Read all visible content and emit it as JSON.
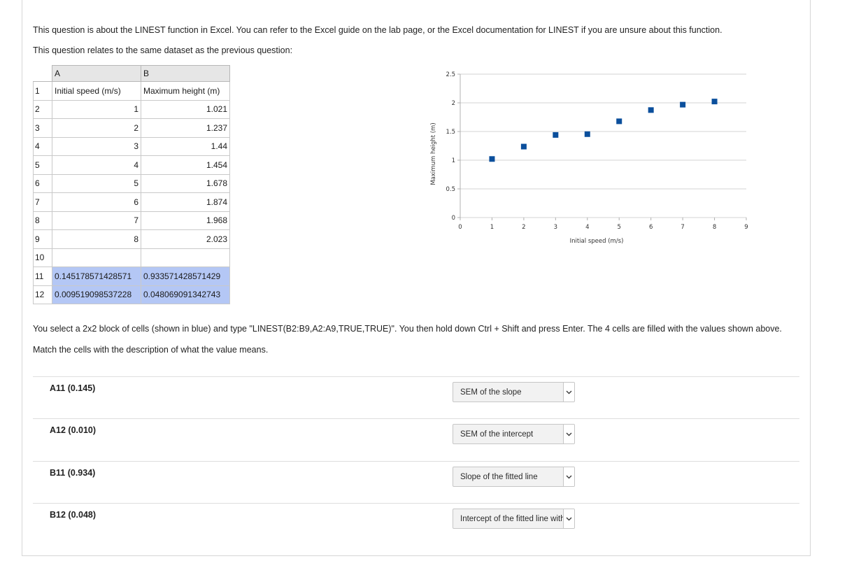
{
  "intro": {
    "line1": "This question is about the LINEST function in Excel. You can refer to the Excel guide on the lab page, or the Excel documentation for LINEST if you are unsure about this function.",
    "line2": "This question relates to the same dataset as the previous question:"
  },
  "sheet": {
    "col_headers": [
      "A",
      "B"
    ],
    "rows": [
      {
        "n": "1",
        "a": "Initial speed (m/s)",
        "b": "Maximum height (m)"
      },
      {
        "n": "2",
        "a": "1",
        "b": "1.021"
      },
      {
        "n": "3",
        "a": "2",
        "b": "1.237"
      },
      {
        "n": "4",
        "a": "3",
        "b": "1.44"
      },
      {
        "n": "5",
        "a": "4",
        "b": "1.454"
      },
      {
        "n": "6",
        "a": "5",
        "b": "1.678"
      },
      {
        "n": "7",
        "a": "6",
        "b": "1.874"
      },
      {
        "n": "8",
        "a": "7",
        "b": "1.968"
      },
      {
        "n": "9",
        "a": "8",
        "b": "2.023"
      },
      {
        "n": "10",
        "a": "",
        "b": ""
      },
      {
        "n": "11",
        "a": "0.145178571428571",
        "b": "0.933571428571429"
      },
      {
        "n": "12",
        "a": "0.009519098537228",
        "b": "0.048069091342743"
      }
    ]
  },
  "chart_data": {
    "type": "scatter",
    "title": "",
    "xlabel": "Initial speed (m/s)",
    "ylabel": "Maximum height (m)",
    "x": [
      1,
      2,
      3,
      4,
      5,
      6,
      7,
      8
    ],
    "y": [
      1.021,
      1.237,
      1.44,
      1.454,
      1.678,
      1.874,
      1.968,
      2.023
    ],
    "xlim": [
      0,
      9
    ],
    "ylim": [
      0,
      2.5
    ],
    "xticks": [
      "0",
      "1",
      "2",
      "3",
      "4",
      "5",
      "6",
      "7",
      "8",
      "9"
    ],
    "yticks": [
      "0",
      "0.5",
      "1",
      "1.5",
      "2",
      "2.5"
    ],
    "grid": "horizontal",
    "marker_color": "#0b4f9c",
    "marker": "square"
  },
  "instructions": {
    "line1": "You select a 2x2 block of cells (shown in blue) and type \"LINEST(B2:B9,A2:A9,TRUE,TRUE)\". You then hold down Ctrl + Shift and press Enter. The 4 cells are filled with the values shown above.",
    "line2": "Match the cells with the description of what the value means."
  },
  "matching": [
    {
      "label": "A11 (0.145)",
      "selected": "SEM of the slope"
    },
    {
      "label": "A12 (0.010)",
      "selected": "SEM of the intercept"
    },
    {
      "label": "B11 (0.934)",
      "selected": "Slope of the fitted line"
    },
    {
      "label": "B12 (0.048)",
      "selected": "Intercept of the fitted line with the y-axis"
    }
  ],
  "icons": {
    "dropdown": "chevron-down-icon"
  }
}
